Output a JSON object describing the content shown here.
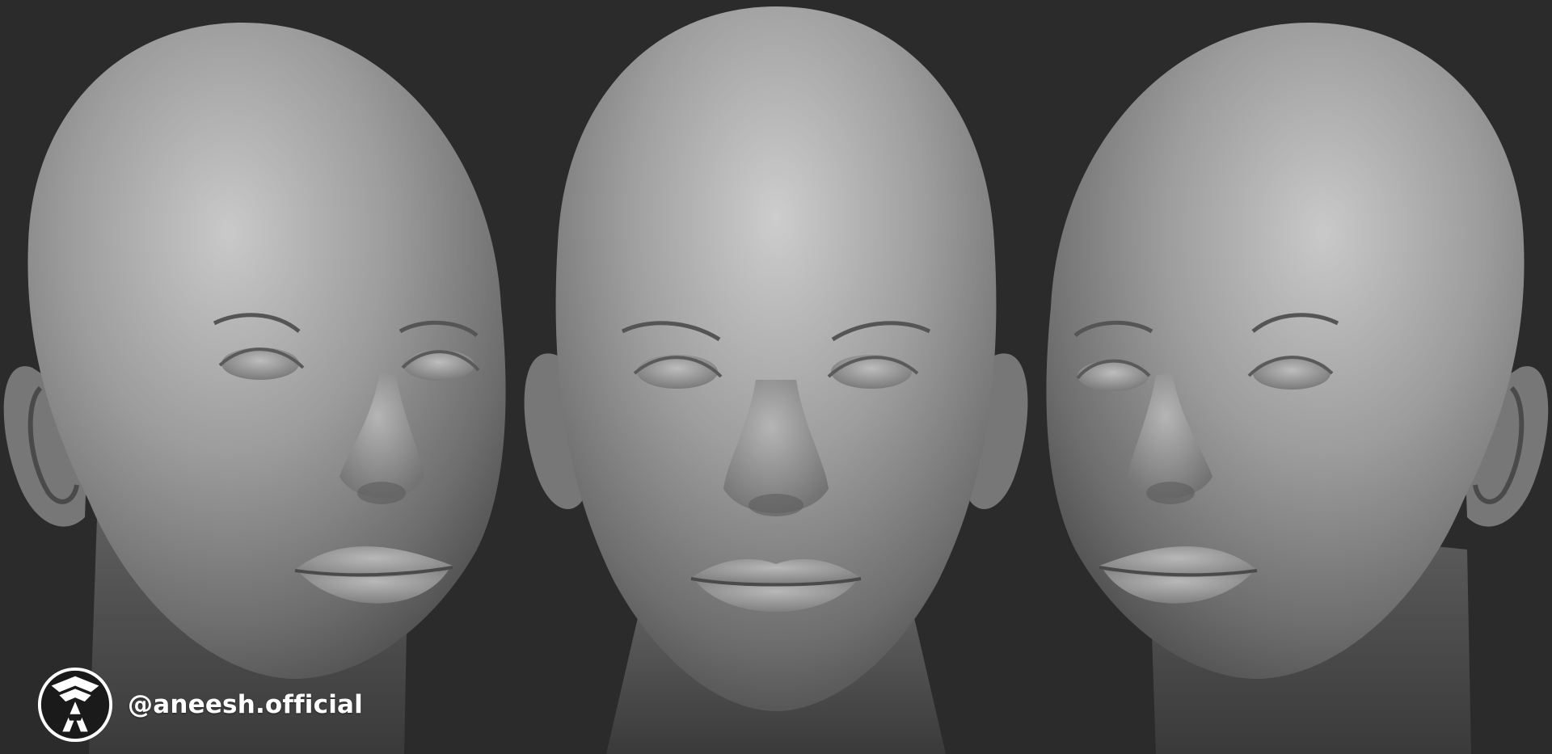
{
  "watermark": {
    "handle": "@aneesh.official",
    "logo_icon": "stylized-a-monogram-emblem-icon"
  },
  "colors": {
    "background": "#2b2b2b",
    "sculpt_clay": "#8a8a8a",
    "watermark_text": "#ffffff"
  },
  "views": [
    "three-quarter-left",
    "front",
    "three-quarter-right"
  ]
}
